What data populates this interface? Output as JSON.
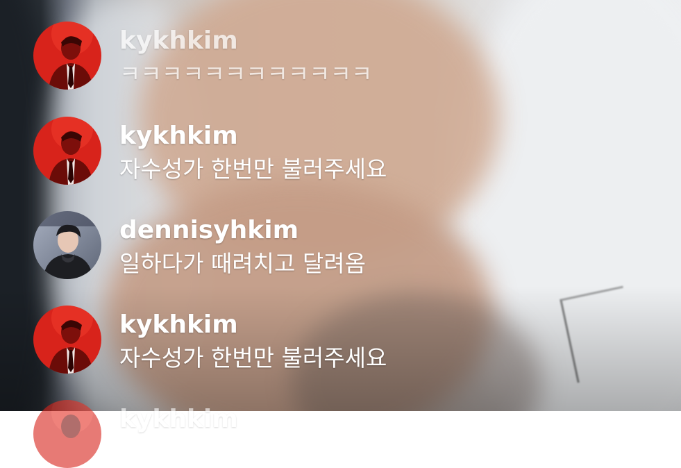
{
  "comments": [
    {
      "username": "kykhkim",
      "message": "ㅋㅋㅋㅋㅋㅋㅋㅋㅋㅋㅋㅋ",
      "avatar": "red-portrait-avatar"
    },
    {
      "username": "kykhkim",
      "message": "자수성가 한번만 불러주세요",
      "avatar": "red-portrait-avatar"
    },
    {
      "username": "dennisyhkim",
      "message": "일하다가 때려치고 달려옴",
      "avatar": "hoodie-portrait-avatar"
    },
    {
      "username": "kykhkim",
      "message": "자수성가 한번만 불러주세요",
      "avatar": "red-portrait-avatar"
    },
    {
      "username": "kykhkim",
      "message": "",
      "avatar": "red-portrait-avatar"
    }
  ],
  "colors": {
    "text": "#ffffff",
    "red_avatar_bg": "#d8231b",
    "hoodie_avatar_bg": "#8a93a6"
  }
}
